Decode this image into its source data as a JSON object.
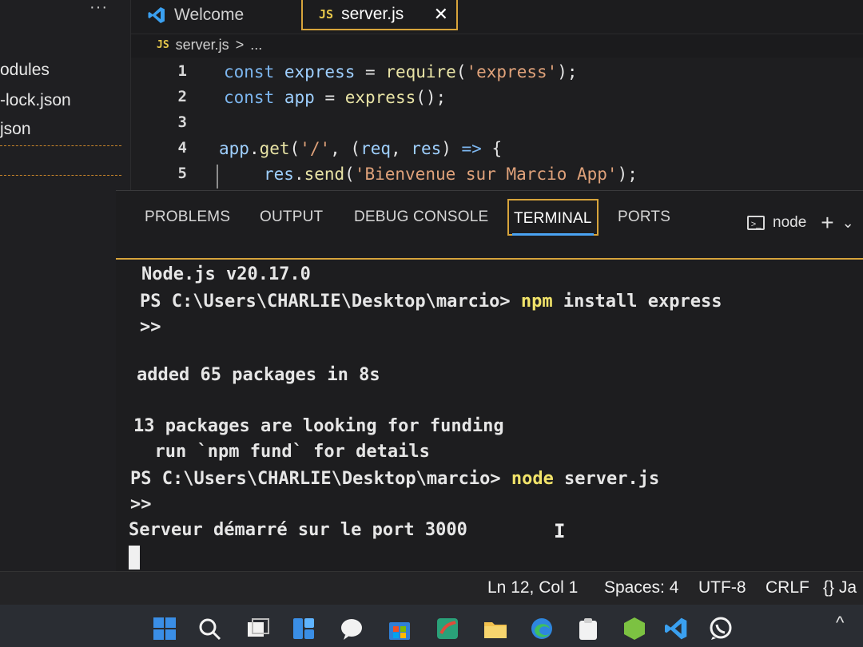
{
  "explorer": {
    "more": "···",
    "files": [
      "odules",
      "-lock.json",
      "json"
    ]
  },
  "tabs": [
    {
      "label": "Welcome"
    },
    {
      "label": "server.js",
      "badge": "JS",
      "close": "✕"
    }
  ],
  "breadcrumb": {
    "badge": "JS",
    "file": "server.js",
    "sep": ">",
    "more": "..."
  },
  "editor": {
    "line_numbers": [
      "1",
      "2",
      "3",
      "4",
      "5"
    ],
    "lines": [
      {
        "a": "const ",
        "b": "express",
        "c": " = ",
        "d": "require",
        "e": "(",
        "f": "'express'",
        "g": ");"
      },
      {
        "a": "const ",
        "b": "app",
        "c": " = ",
        "d": "express",
        "e": "();"
      },
      {},
      {
        "a": "app",
        "b": ".",
        "c": "get",
        "d": "(",
        "e": "'/'",
        "f": ", (",
        "g": "req",
        "h": ", ",
        "i": "res",
        "j": ") ",
        "k": "=>",
        "l": " {"
      },
      {
        "a": "res",
        "b": ".",
        "c": "send",
        "d": "(",
        "e": "'Bienvenue sur Marcio App'",
        "f": ");"
      }
    ]
  },
  "panel": {
    "tabs": [
      "PROBLEMS",
      "OUTPUT",
      "DEBUG CONSOLE",
      "TERMINAL",
      "PORTS"
    ],
    "active_tab": "TERMINAL",
    "terminal_name": "node",
    "add": "+",
    "dropdown": "⌄"
  },
  "terminal": {
    "version": "Node.js v20.17.0",
    "prompt1": "PS C:\\Users\\CHARLIE\\Desktop\\marcio> ",
    "cmd1": "npm",
    "cmd1_rest": " install express",
    "cont1": ">>",
    "added": "added 65 packages in 8s",
    "funding1": "13 packages are looking for funding",
    "funding2": "  run `npm fund` for details",
    "prompt2": "PS C:\\Users\\CHARLIE\\Desktop\\marcio> ",
    "cmd2": "node",
    "cmd2_rest": " server.js",
    "cont2": ">>",
    "server": "Serveur démarré sur le port 3000",
    "ibeam": "I"
  },
  "statusbar": {
    "position": "Ln 12, Col 1",
    "spaces": "Spaces: 4",
    "encoding": "UTF-8",
    "eol": "CRLF",
    "language": "{} Ja"
  },
  "taskbar": {
    "icons": [
      "windows-start",
      "search",
      "task-view",
      "widgets",
      "chat",
      "store",
      "winrar",
      "file-explorer",
      "edge",
      "clipboard",
      "node",
      "vscode",
      "whatsapp"
    ],
    "tray": "^",
    "colors": {
      "blue": "#3a8ee6",
      "green": "#3fbf5f",
      "yellow": "#f2c14e",
      "white": "#f2f2f2"
    }
  }
}
